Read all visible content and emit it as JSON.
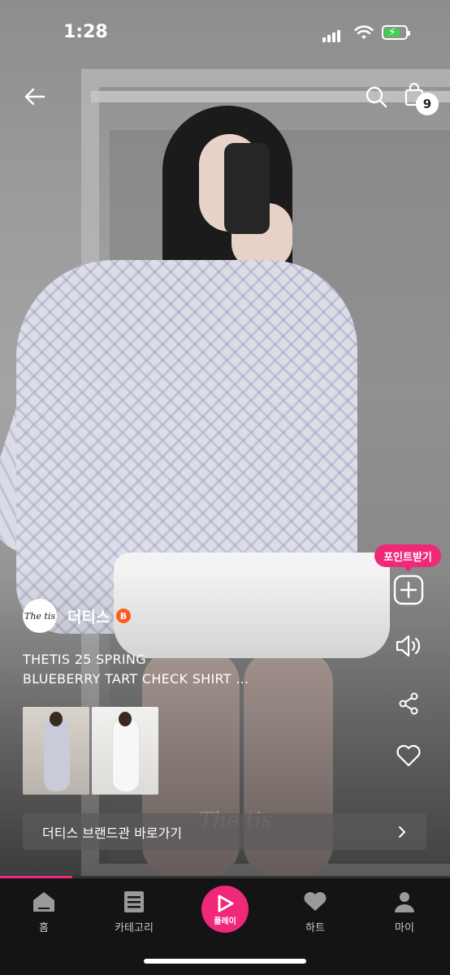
{
  "status_bar": {
    "time": "1:28"
  },
  "header": {
    "cart_count": "9"
  },
  "side": {
    "point_label": "포인트받기"
  },
  "brand": {
    "logo_text": "The tis",
    "name": "더티스",
    "badge": "B"
  },
  "product": {
    "title_line1": "THETIS 25 SPRING",
    "title_line2": "BLUEBERRY TART CHECK SHIRT ..."
  },
  "brand_link": {
    "label": "더티스 브랜드관 바로가기"
  },
  "watermark": "The tis",
  "progress": 0.16,
  "tabs": [
    {
      "label": "홈",
      "icon": "home-icon"
    },
    {
      "label": "카테고리",
      "icon": "category-icon"
    },
    {
      "label": "플레이",
      "icon": "play-icon"
    },
    {
      "label": "하트",
      "icon": "heart-icon"
    },
    {
      "label": "마이",
      "icon": "person-icon"
    }
  ],
  "colors": {
    "accent": "#f0287a",
    "brand_badge": "#ff5a1f",
    "battery": "#3fd14b"
  }
}
